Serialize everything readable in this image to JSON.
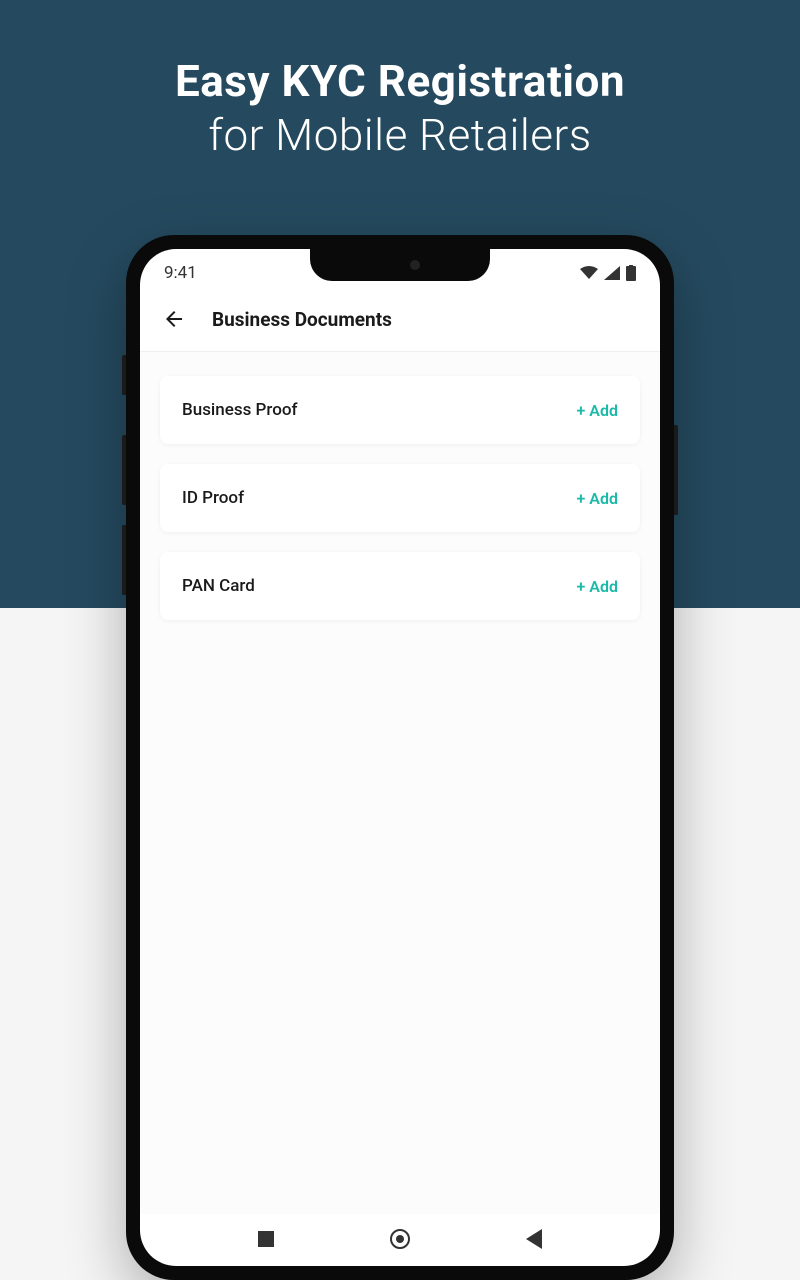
{
  "promo": {
    "line1": "Easy KYC Registration",
    "line2": "for Mobile Retailers"
  },
  "status_bar": {
    "time": "9:41"
  },
  "header": {
    "title": "Business Documents"
  },
  "documents": [
    {
      "label": "Business Proof",
      "action": "+ Add"
    },
    {
      "label": "ID Proof",
      "action": "+ Add"
    },
    {
      "label": "PAN Card",
      "action": "+ Add"
    }
  ],
  "colors": {
    "accent": "#1cb9a8",
    "bg_top": "#254a5f"
  }
}
